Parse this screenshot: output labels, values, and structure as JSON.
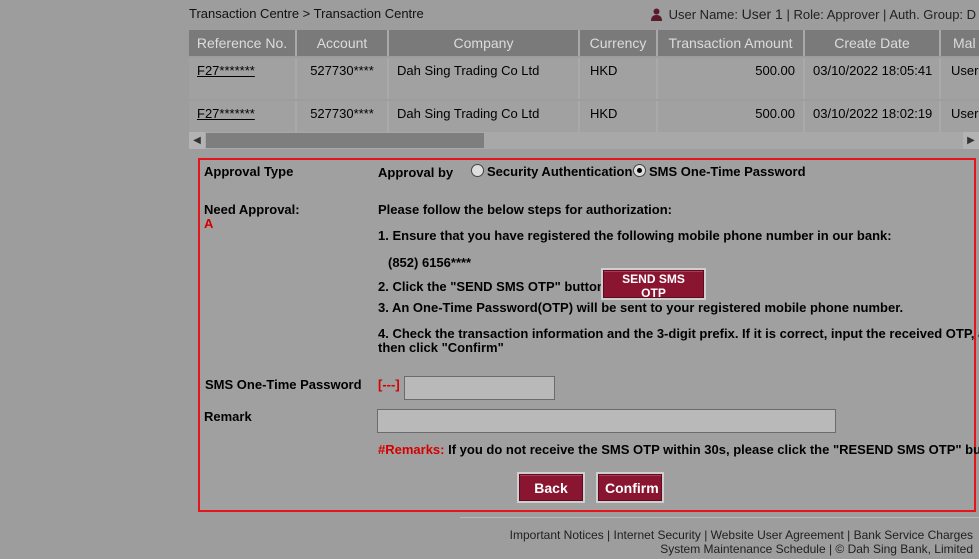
{
  "breadcrumb": {
    "text": "Transaction Centre > Transaction Centre"
  },
  "user": {
    "name_label": "User Name:",
    "name": "User 1",
    "role_text": "| Role: Approver | Auth. Group: D"
  },
  "table": {
    "headers": [
      "Reference No.",
      "Account",
      "Company",
      "Currency",
      "Transaction Amount",
      "Create Date",
      "Mal"
    ],
    "rows": [
      {
        "ref": "F27*******",
        "account": "527730****",
        "company": "Dah Sing Trading Co Ltd",
        "currency": "HKD",
        "amount": "500.00",
        "date": "03/10/2022 18:05:41",
        "maker": "User"
      },
      {
        "ref": "F27*******",
        "account": "527730****",
        "company": "Dah Sing Trading Co Ltd",
        "currency": "HKD",
        "amount": "500.00",
        "date": "03/10/2022 18:02:19",
        "maker": "User"
      }
    ]
  },
  "approval": {
    "type_label": "Approval Type",
    "by_label": "Approval by",
    "options": [
      "Security Authentication",
      "SMS One-Time Password"
    ],
    "selected": "SMS One-Time Password",
    "need_label": "Need Approval:",
    "need_value": "A",
    "steps_intro": "Please follow the below steps for authorization:",
    "step1": "1. Ensure that you have registered the following mobile phone number in our bank:",
    "phone": "(852) 6156****",
    "step2": "2. Click the \"SEND SMS OTP\" button",
    "send_button": "SEND SMS OTP",
    "step3": "3. An One-Time Password(OTP) will be sent to your registered mobile phone number.",
    "step4_line1": "4. Check the transaction information and the 3-digit prefix. If it is correct, input the received OTP, and",
    "step4_line2": "then click \"Confirm\"",
    "otp_label": "SMS One-Time Password",
    "otp_prefix": "[---]",
    "otp_value": "",
    "remark_label": "Remark",
    "remark_value": "",
    "remarks_label": "#Remarks:",
    "remarks_text": "If you do not receive the SMS OTP within 30s, please click the \"RESEND SMS OTP\" button.",
    "back_button": "Back",
    "confirm_button": "Confirm"
  },
  "footer": {
    "line1": "Important Notices | Internet Security | Website User Agreement | Bank Service Charges",
    "line2": "System Maintenance Schedule | © Dah Sing Bank, Limited"
  },
  "colors": {
    "accent": "#8a1530",
    "border_red": "#e4161b"
  }
}
